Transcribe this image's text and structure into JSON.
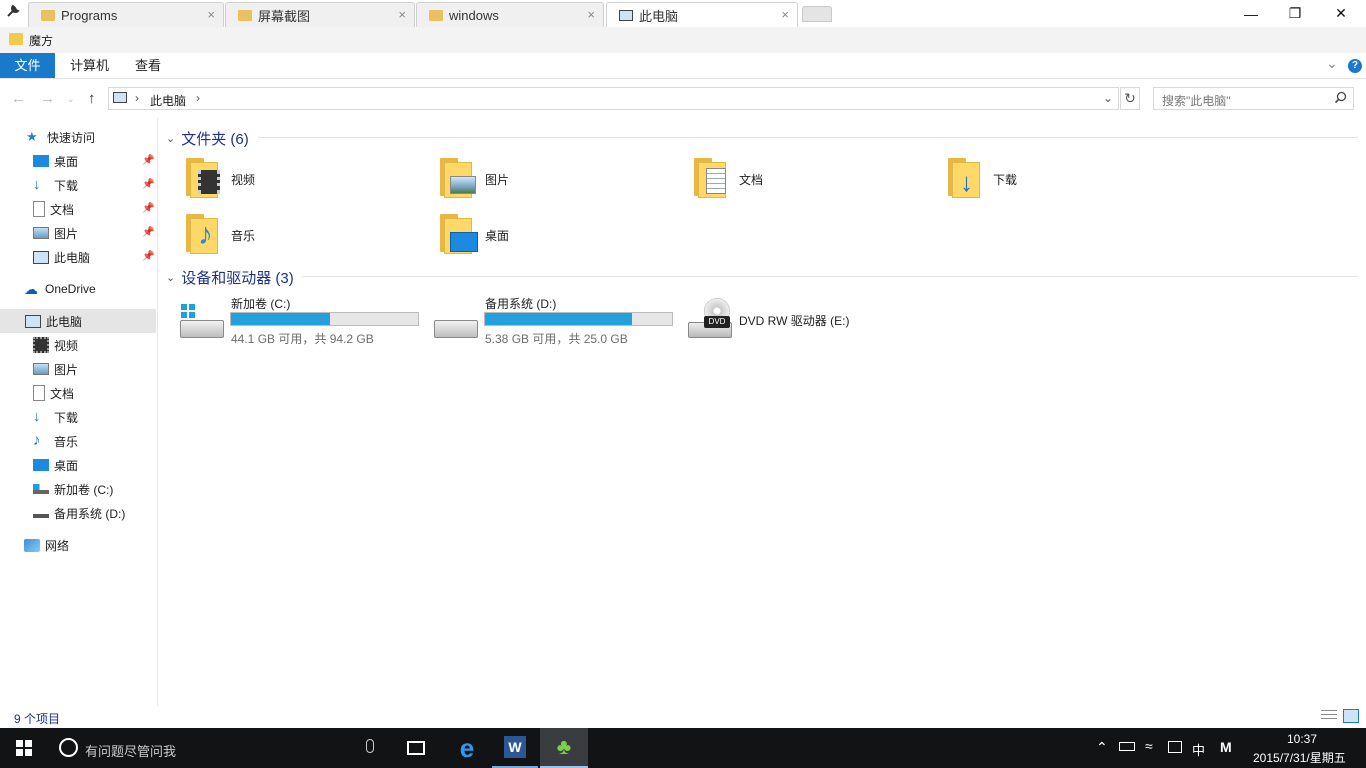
{
  "tabs": [
    {
      "label": "Programs",
      "close": "×"
    },
    {
      "label": "屏幕截图",
      "close": "×"
    },
    {
      "label": "windows",
      "close": "×"
    },
    {
      "label": "此电脑",
      "close": "×"
    }
  ],
  "window": {
    "minimize": "—",
    "restore": "❐",
    "close": "✕"
  },
  "title_folder": "魔方",
  "ribbon": {
    "file": "文件",
    "computer": "计算机",
    "view": "查看",
    "help": "?",
    "expand": "⌄"
  },
  "address": {
    "crumb_sep": "›",
    "crumb_current": "此电脑",
    "crumb_sep2": "›",
    "search_placeholder": "搜索\"此电脑\""
  },
  "sidebar": {
    "quick_access": "快速访问",
    "pinned": [
      "桌面",
      "下载",
      "文档",
      "图片",
      "此电脑"
    ],
    "onedrive": "OneDrive",
    "this_pc": "此电脑",
    "pc_items": [
      "视频",
      "图片",
      "文档",
      "下载",
      "音乐",
      "桌面",
      "新加卷 (C:)",
      "备用系统 (D:)"
    ],
    "network": "网络"
  },
  "content": {
    "folders_header": "文件夹 (6)",
    "folders": [
      "视频",
      "图片",
      "文档",
      "下载",
      "音乐",
      "桌面"
    ],
    "devices_header": "设备和驱动器 (3)",
    "drives": [
      {
        "name": "新加卷 (C:)",
        "free": "44.1 GB 可用，共 94.2 GB",
        "used_fraction": 0.532
      },
      {
        "name": "备用系统 (D:)",
        "free": "5.38 GB 可用，共 25.0 GB",
        "used_fraction": 0.785
      },
      {
        "name": "DVD RW 驱动器 (E:)",
        "dvd_label": "DVD"
      }
    ]
  },
  "status": {
    "count": "9 个项目"
  },
  "taskbar": {
    "search_placeholder": "有问题尽管问我",
    "ime": "中",
    "time": "10:37",
    "date": "2015/7/31/星期五"
  },
  "colors": {
    "accent": "#1979ca",
    "progress": "#26a0da",
    "folder": "#ffd868",
    "taskbar": "#111315"
  }
}
